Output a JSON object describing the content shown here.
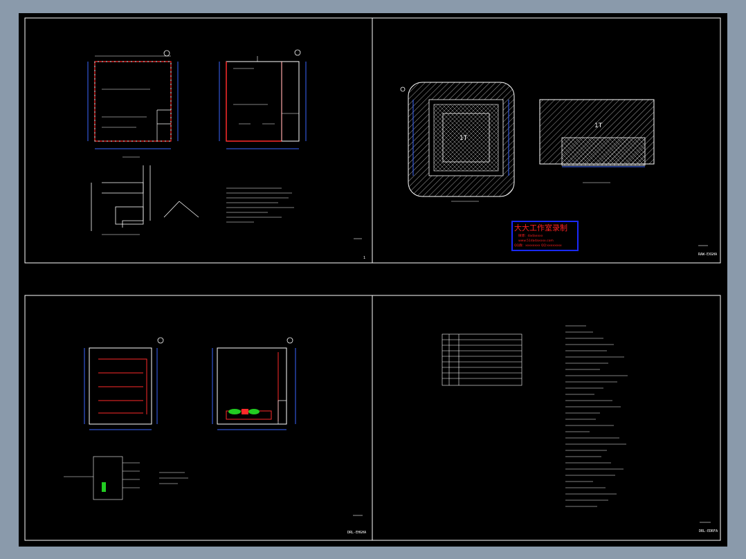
{
  "watermark": {
    "title": "大大工作室录制",
    "line1": "微博：dadaxxxx",
    "line2": "www.51dadaxxxx.com",
    "line3": "QQ群：xxxxxxxx  QQ:xxxxxxxx"
  },
  "sheets": {
    "s1": {
      "number": "1"
    },
    "s2": {
      "code": "RAW-EXGHA"
    },
    "s3": {
      "code": "DRL-EHGHA"
    },
    "s4": {
      "code": "DRL-EDRFA"
    }
  },
  "labels": {
    "t1": "1T",
    "t2": "1T"
  },
  "colors": {
    "background": "#000000",
    "linework": "#ffffff",
    "dimensions": "#3a66ff",
    "electrical": "#ff2a2a",
    "equipment": "#22cc22",
    "watermark_title": "#ff2020",
    "watermark_box": "#1a2aff"
  }
}
